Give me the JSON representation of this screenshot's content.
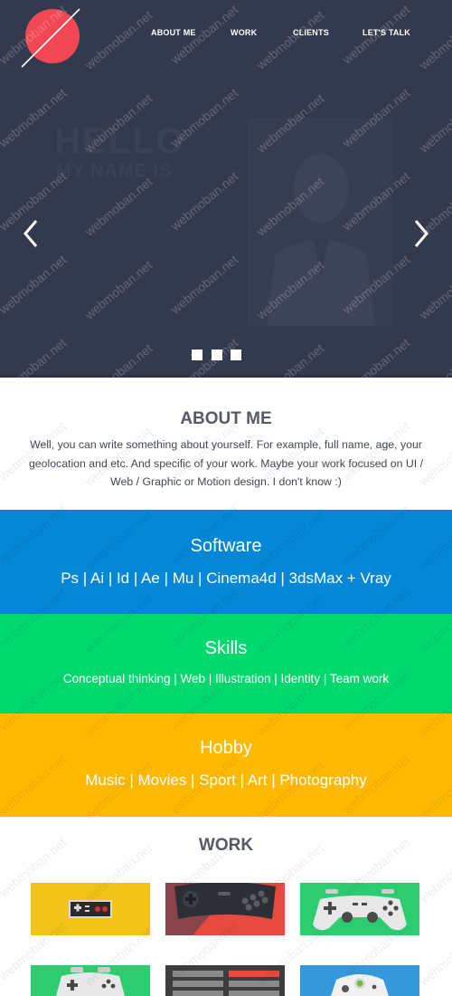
{
  "nav": {
    "items": [
      "ABOUT ME",
      "WORK",
      "CLIENTS",
      "LET'S TALK"
    ]
  },
  "hero": {
    "ghost_heading": "HELLO",
    "ghost_subheading": "MY NAME IS",
    "prev_icon": "chevron-left-icon",
    "next_icon": "chevron-right-icon",
    "slide_count": 3
  },
  "about": {
    "title": "ABOUT ME",
    "text": "Well, you can write something about yourself. For example, full name, age, your geolocation and etc. And specific of your work. Maybe your work focused on UI / Web / Graphic or Motion design. I don't know :)"
  },
  "software": {
    "title": "Software",
    "items": "Ps | Ai | Id | Ae | Mu | Cinema4d | 3dsMax + Vray"
  },
  "skills": {
    "title": "Skills",
    "items": "Conceptual thinking | Web | Illustration | Identity | Team work"
  },
  "hobby": {
    "title": "Hobby",
    "items": "Music | Movies | Sport | Art | Photography"
  },
  "work": {
    "title": "WORK",
    "tiles": [
      {
        "name": "nes-controller",
        "bg": "#f2c318"
      },
      {
        "name": "sega-controller",
        "bg": "#e84a3f"
      },
      {
        "name": "playstation-controller",
        "bg": "#2ecc71"
      },
      {
        "name": "playstation-controller-2",
        "bg": "#2ecc71"
      },
      {
        "name": "arcade-panel",
        "bg": "#3d3d3d"
      },
      {
        "name": "xbox-controller",
        "bg": "#3498db"
      }
    ]
  },
  "watermark": "webmoban.net",
  "colors": {
    "hero_bg": "#343a4e",
    "logo": "#f24855",
    "software_band": "#0487d4",
    "skills_band": "#00d96e",
    "hobby_band": "#ffba00",
    "heading_text": "#555a65"
  }
}
